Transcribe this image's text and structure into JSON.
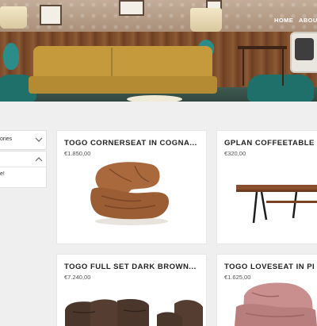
{
  "nav": {
    "items": [
      {
        "label": "HOME"
      },
      {
        "label": "ABOUT"
      }
    ]
  },
  "sidebar": {
    "categories_label": "ories",
    "second_item_label": "e!"
  },
  "products": [
    {
      "title": "TOGO CORNERSEAT IN COGNA...",
      "price": "€1.850,00"
    },
    {
      "title": "GPLAN COFFEETABLE",
      "price": "€320,00"
    },
    {
      "title": "TOGO FULL SET DARK BROWN...",
      "price": "€7.240,00"
    },
    {
      "title": "TOGO LOVESEAT IN PI",
      "price": "€1.625,00"
    }
  ],
  "colors": {
    "page_bg": "#efefef",
    "card_bg": "#ffffff",
    "nav_text": "#ffffff",
    "cognac_leather": "#a9693d",
    "dark_brown_leather": "#4a362b",
    "pink_velvet": "#c98f8f"
  }
}
